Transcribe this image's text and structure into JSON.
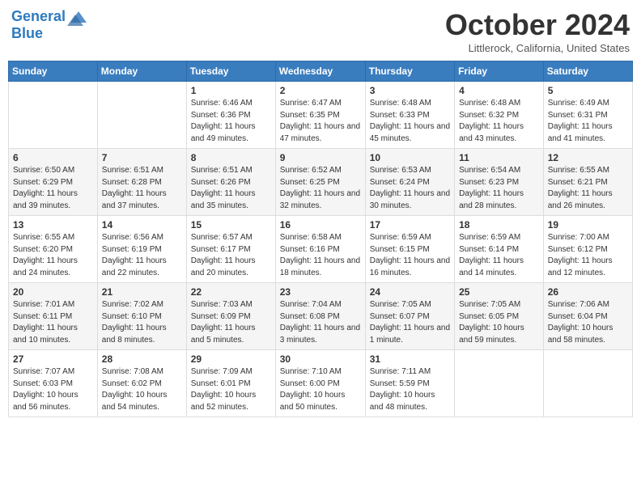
{
  "header": {
    "logo_line1": "General",
    "logo_line2": "Blue",
    "month_title": "October 2024",
    "location": "Littlerock, California, United States"
  },
  "days_of_week": [
    "Sunday",
    "Monday",
    "Tuesday",
    "Wednesday",
    "Thursday",
    "Friday",
    "Saturday"
  ],
  "weeks": [
    [
      {
        "num": "",
        "sunrise": "",
        "sunset": "",
        "daylight": ""
      },
      {
        "num": "",
        "sunrise": "",
        "sunset": "",
        "daylight": ""
      },
      {
        "num": "1",
        "sunrise": "Sunrise: 6:46 AM",
        "sunset": "Sunset: 6:36 PM",
        "daylight": "Daylight: 11 hours and 49 minutes."
      },
      {
        "num": "2",
        "sunrise": "Sunrise: 6:47 AM",
        "sunset": "Sunset: 6:35 PM",
        "daylight": "Daylight: 11 hours and 47 minutes."
      },
      {
        "num": "3",
        "sunrise": "Sunrise: 6:48 AM",
        "sunset": "Sunset: 6:33 PM",
        "daylight": "Daylight: 11 hours and 45 minutes."
      },
      {
        "num": "4",
        "sunrise": "Sunrise: 6:48 AM",
        "sunset": "Sunset: 6:32 PM",
        "daylight": "Daylight: 11 hours and 43 minutes."
      },
      {
        "num": "5",
        "sunrise": "Sunrise: 6:49 AM",
        "sunset": "Sunset: 6:31 PM",
        "daylight": "Daylight: 11 hours and 41 minutes."
      }
    ],
    [
      {
        "num": "6",
        "sunrise": "Sunrise: 6:50 AM",
        "sunset": "Sunset: 6:29 PM",
        "daylight": "Daylight: 11 hours and 39 minutes."
      },
      {
        "num": "7",
        "sunrise": "Sunrise: 6:51 AM",
        "sunset": "Sunset: 6:28 PM",
        "daylight": "Daylight: 11 hours and 37 minutes."
      },
      {
        "num": "8",
        "sunrise": "Sunrise: 6:51 AM",
        "sunset": "Sunset: 6:26 PM",
        "daylight": "Daylight: 11 hours and 35 minutes."
      },
      {
        "num": "9",
        "sunrise": "Sunrise: 6:52 AM",
        "sunset": "Sunset: 6:25 PM",
        "daylight": "Daylight: 11 hours and 32 minutes."
      },
      {
        "num": "10",
        "sunrise": "Sunrise: 6:53 AM",
        "sunset": "Sunset: 6:24 PM",
        "daylight": "Daylight: 11 hours and 30 minutes."
      },
      {
        "num": "11",
        "sunrise": "Sunrise: 6:54 AM",
        "sunset": "Sunset: 6:23 PM",
        "daylight": "Daylight: 11 hours and 28 minutes."
      },
      {
        "num": "12",
        "sunrise": "Sunrise: 6:55 AM",
        "sunset": "Sunset: 6:21 PM",
        "daylight": "Daylight: 11 hours and 26 minutes."
      }
    ],
    [
      {
        "num": "13",
        "sunrise": "Sunrise: 6:55 AM",
        "sunset": "Sunset: 6:20 PM",
        "daylight": "Daylight: 11 hours and 24 minutes."
      },
      {
        "num": "14",
        "sunrise": "Sunrise: 6:56 AM",
        "sunset": "Sunset: 6:19 PM",
        "daylight": "Daylight: 11 hours and 22 minutes."
      },
      {
        "num": "15",
        "sunrise": "Sunrise: 6:57 AM",
        "sunset": "Sunset: 6:17 PM",
        "daylight": "Daylight: 11 hours and 20 minutes."
      },
      {
        "num": "16",
        "sunrise": "Sunrise: 6:58 AM",
        "sunset": "Sunset: 6:16 PM",
        "daylight": "Daylight: 11 hours and 18 minutes."
      },
      {
        "num": "17",
        "sunrise": "Sunrise: 6:59 AM",
        "sunset": "Sunset: 6:15 PM",
        "daylight": "Daylight: 11 hours and 16 minutes."
      },
      {
        "num": "18",
        "sunrise": "Sunrise: 6:59 AM",
        "sunset": "Sunset: 6:14 PM",
        "daylight": "Daylight: 11 hours and 14 minutes."
      },
      {
        "num": "19",
        "sunrise": "Sunrise: 7:00 AM",
        "sunset": "Sunset: 6:12 PM",
        "daylight": "Daylight: 11 hours and 12 minutes."
      }
    ],
    [
      {
        "num": "20",
        "sunrise": "Sunrise: 7:01 AM",
        "sunset": "Sunset: 6:11 PM",
        "daylight": "Daylight: 11 hours and 10 minutes."
      },
      {
        "num": "21",
        "sunrise": "Sunrise: 7:02 AM",
        "sunset": "Sunset: 6:10 PM",
        "daylight": "Daylight: 11 hours and 8 minutes."
      },
      {
        "num": "22",
        "sunrise": "Sunrise: 7:03 AM",
        "sunset": "Sunset: 6:09 PM",
        "daylight": "Daylight: 11 hours and 5 minutes."
      },
      {
        "num": "23",
        "sunrise": "Sunrise: 7:04 AM",
        "sunset": "Sunset: 6:08 PM",
        "daylight": "Daylight: 11 hours and 3 minutes."
      },
      {
        "num": "24",
        "sunrise": "Sunrise: 7:05 AM",
        "sunset": "Sunset: 6:07 PM",
        "daylight": "Daylight: 11 hours and 1 minute."
      },
      {
        "num": "25",
        "sunrise": "Sunrise: 7:05 AM",
        "sunset": "Sunset: 6:05 PM",
        "daylight": "Daylight: 10 hours and 59 minutes."
      },
      {
        "num": "26",
        "sunrise": "Sunrise: 7:06 AM",
        "sunset": "Sunset: 6:04 PM",
        "daylight": "Daylight: 10 hours and 58 minutes."
      }
    ],
    [
      {
        "num": "27",
        "sunrise": "Sunrise: 7:07 AM",
        "sunset": "Sunset: 6:03 PM",
        "daylight": "Daylight: 10 hours and 56 minutes."
      },
      {
        "num": "28",
        "sunrise": "Sunrise: 7:08 AM",
        "sunset": "Sunset: 6:02 PM",
        "daylight": "Daylight: 10 hours and 54 minutes."
      },
      {
        "num": "29",
        "sunrise": "Sunrise: 7:09 AM",
        "sunset": "Sunset: 6:01 PM",
        "daylight": "Daylight: 10 hours and 52 minutes."
      },
      {
        "num": "30",
        "sunrise": "Sunrise: 7:10 AM",
        "sunset": "Sunset: 6:00 PM",
        "daylight": "Daylight: 10 hours and 50 minutes."
      },
      {
        "num": "31",
        "sunrise": "Sunrise: 7:11 AM",
        "sunset": "Sunset: 5:59 PM",
        "daylight": "Daylight: 10 hours and 48 minutes."
      },
      {
        "num": "",
        "sunrise": "",
        "sunset": "",
        "daylight": ""
      },
      {
        "num": "",
        "sunrise": "",
        "sunset": "",
        "daylight": ""
      }
    ]
  ]
}
